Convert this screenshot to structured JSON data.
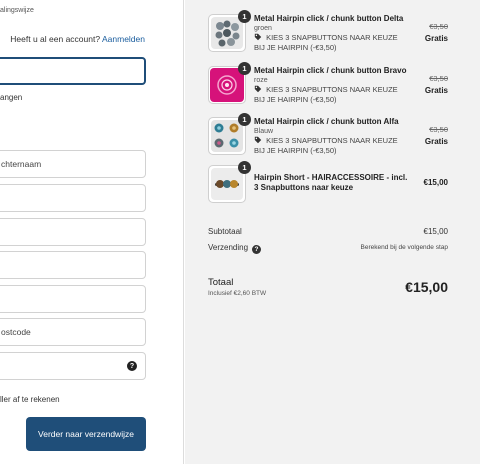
{
  "left": {
    "breadcrumb": "alingswijze",
    "account_prompt": "Heeft u al een account?",
    "account_link": "Aanmelden",
    "newsletter_label": "angen",
    "fields": {
      "last_name": "chternaam",
      "postcode": "ostcode"
    },
    "billing_label": "ller af te rekenen",
    "continue_button": "Verder naar verzendwijze"
  },
  "cart": {
    "items": [
      {
        "quantity": "1",
        "name": "Metal Hairpin click / chunk button Delta",
        "variant": "groen",
        "addon": "KIES 3 SNAPBUTTONS NAAR KEUZE BIJ JE HAIRPIN (-€3,50)",
        "old_price": "€3,50",
        "price": "Gratis",
        "thumb_color": "#9aa3a8",
        "thumb_icon": "snap-buttons-thumb"
      },
      {
        "quantity": "1",
        "name": "Metal Hairpin click / chunk button Bravo",
        "variant": "roze",
        "addon": "KIES 3 SNAPBUTTONS NAAR KEUZE BIJ JE HAIRPIN (-€3,50)",
        "old_price": "€3,50",
        "price": "Gratis",
        "thumb_color": "#d6127a",
        "thumb_icon": "pink-hairpin-thumb"
      },
      {
        "quantity": "1",
        "name": "Metal Hairpin click / chunk button Alfa",
        "variant": "Blauw",
        "addon": "KIES 3 SNAPBUTTONS NAAR KEUZE BIJ JE HAIRPIN (-€3,50)",
        "old_price": "€3,50",
        "price": "Gratis",
        "thumb_color": "#3a8fa8",
        "thumb_icon": "blue-buttons-thumb"
      },
      {
        "quantity": "1",
        "name": "Hairpin Short - HAIRACCESSOIRE - incl. 3 Snapbuttons naar keuze",
        "price": "€15,00",
        "thumb_color": "#5a4a3a",
        "thumb_icon": "hairpin-short-thumb"
      }
    ],
    "subtotal_label": "Subtotaal",
    "subtotal_value": "€15,00",
    "shipping_label": "Verzending",
    "shipping_value": "Berekend bij de volgende stap",
    "total_label": "Totaal",
    "total_tax": "Inclusief €2,60 BTW",
    "total_value": "€15,00"
  }
}
